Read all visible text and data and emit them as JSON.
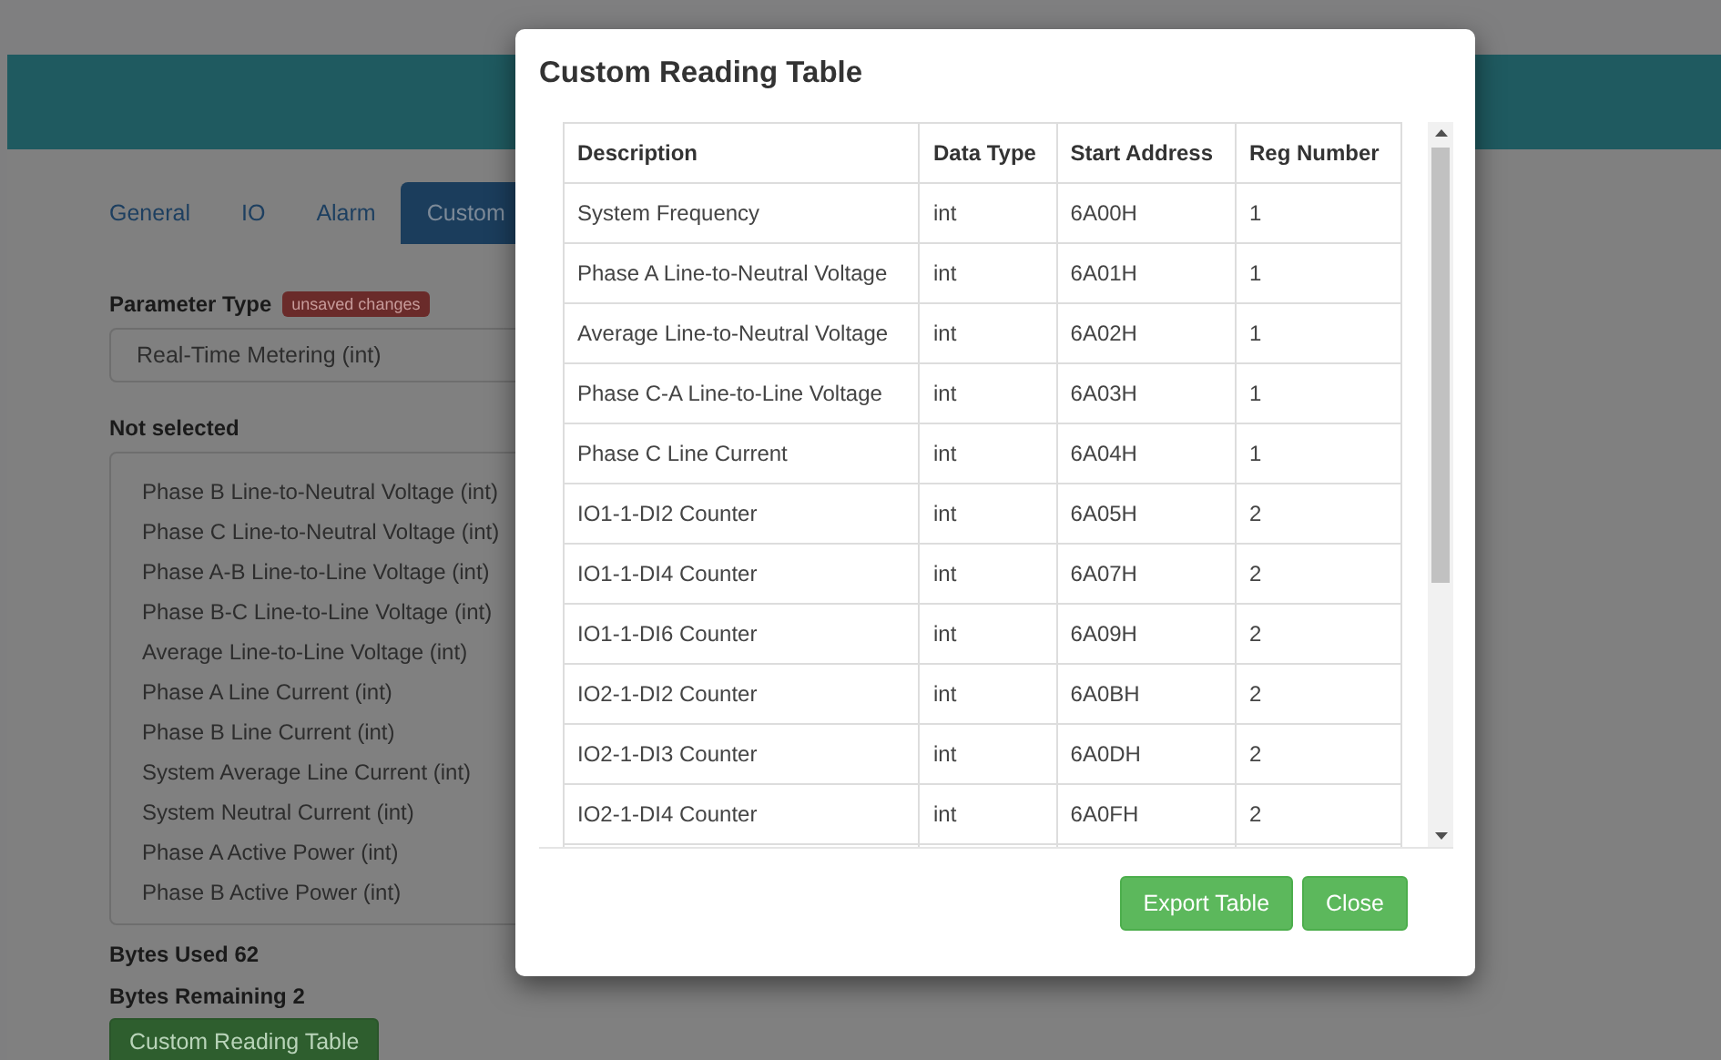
{
  "tabs": [
    {
      "label": "General",
      "selected": false
    },
    {
      "label": "IO",
      "selected": false
    },
    {
      "label": "Alarm",
      "selected": false
    },
    {
      "label": "Custom",
      "selected": true
    }
  ],
  "parameter_type": {
    "label": "Parameter Type",
    "badge": "unsaved changes",
    "value": "Real-Time Metering (int)"
  },
  "not_selected": {
    "label": "Not selected",
    "items": [
      "Phase B Line-to-Neutral Voltage (int)",
      "Phase C Line-to-Neutral Voltage (int)",
      "Phase A-B Line-to-Line Voltage (int)",
      "Phase B-C Line-to-Line Voltage (int)",
      "Average Line-to-Line Voltage (int)",
      "Phase A Line Current (int)",
      "Phase B Line Current (int)",
      "System Average Line Current (int)",
      "System Neutral Current (int)",
      "Phase A Active Power (int)",
      "Phase B Active Power (int)"
    ]
  },
  "bytes_used": "Bytes Used 62",
  "bytes_remaining": "Bytes Remaining 2",
  "custom_button": "Custom Reading Table",
  "modal": {
    "title": "Custom Reading Table",
    "table": {
      "columns": [
        "Description",
        "Data Type",
        "Start Address",
        "Reg Number"
      ],
      "rows": [
        [
          "System Frequency",
          "int",
          "6A00H",
          "1"
        ],
        [
          "Phase A Line-to-Neutral Voltage",
          "int",
          "6A01H",
          "1"
        ],
        [
          "Average Line-to-Neutral Voltage",
          "int",
          "6A02H",
          "1"
        ],
        [
          "Phase C-A Line-to-Line Voltage",
          "int",
          "6A03H",
          "1"
        ],
        [
          "Phase C Line Current",
          "int",
          "6A04H",
          "1"
        ],
        [
          "IO1-1-DI2 Counter",
          "int",
          "6A05H",
          "2"
        ],
        [
          "IO1-1-DI4 Counter",
          "int",
          "6A07H",
          "2"
        ],
        [
          "IO1-1-DI6 Counter",
          "int",
          "6A09H",
          "2"
        ],
        [
          "IO2-1-DI2 Counter",
          "int",
          "6A0BH",
          "2"
        ],
        [
          "IO2-1-DI3 Counter",
          "int",
          "6A0DH",
          "2"
        ],
        [
          "IO2-1-DI4 Counter",
          "int",
          "6A0FH",
          "2"
        ]
      ]
    },
    "buttons": [
      "Export Table",
      "Close"
    ]
  }
}
